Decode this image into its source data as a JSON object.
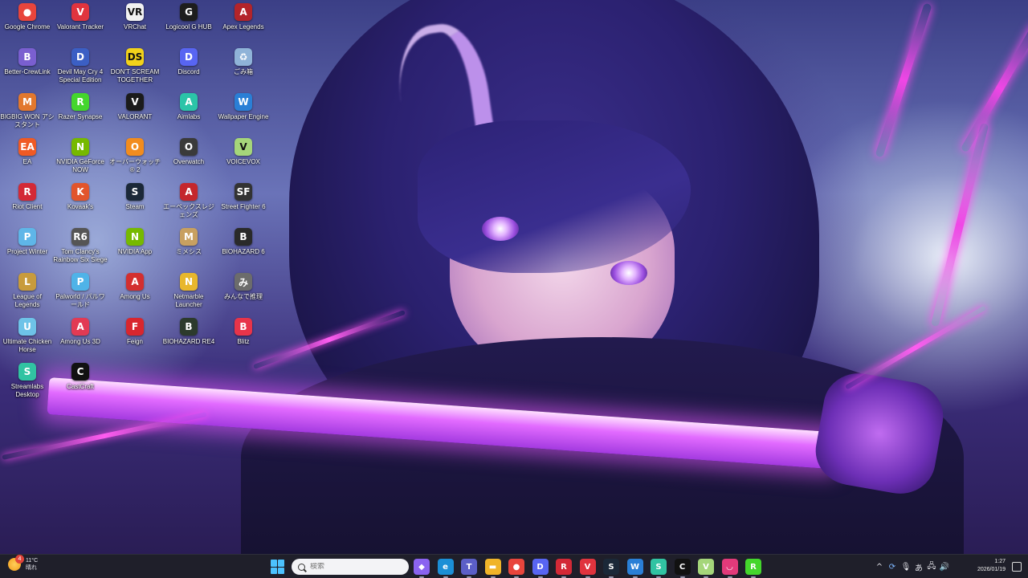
{
  "desktop": {
    "icons": [
      {
        "label": "Google Chrome",
        "glyph": "●",
        "color": "#e8453c"
      },
      {
        "label": "Valorant Tracker",
        "glyph": "V",
        "color": "#e0343e"
      },
      {
        "label": "VRChat",
        "glyph": "VR",
        "color": "#f2f2f2"
      },
      {
        "label": "Logicool G HUB",
        "glyph": "G",
        "color": "#1d1d1d"
      },
      {
        "label": "Apex Legends",
        "glyph": "A",
        "color": "#b3242a"
      },
      {
        "label": "Better-CrewLink",
        "glyph": "B",
        "color": "#7a5fd0"
      },
      {
        "label": "Devil May Cry 4 Special Edition",
        "glyph": "D",
        "color": "#3b5fc4"
      },
      {
        "label": "DON'T SCREAM TOGETHER",
        "glyph": "DS",
        "color": "#f2d21a"
      },
      {
        "label": "Discord",
        "glyph": "D",
        "color": "#5865f2"
      },
      {
        "label": "ごみ箱",
        "glyph": "♻",
        "color": "#8fb3d8"
      },
      {
        "label": "BIGBIG WON アシスタント",
        "glyph": "M",
        "color": "#e2782e"
      },
      {
        "label": "Razer Synapse",
        "glyph": "R",
        "color": "#44d62c"
      },
      {
        "label": "VALORANT",
        "glyph": "V",
        "color": "#1b1b1b"
      },
      {
        "label": "Aimlabs",
        "glyph": "A",
        "color": "#2bc4a8"
      },
      {
        "label": "Wallpaper Engine",
        "glyph": "W",
        "color": "#2a7fd6"
      },
      {
        "label": "EA",
        "glyph": "EA",
        "color": "#f05a24"
      },
      {
        "label": "NVIDIA GeForce NOW",
        "glyph": "N",
        "color": "#76b900"
      },
      {
        "label": "オーバーウォッチ® 2",
        "glyph": "O",
        "color": "#f28c1e"
      },
      {
        "label": "Overwatch",
        "glyph": "O",
        "color": "#3a3a3a"
      },
      {
        "label": "VOICEVOX",
        "glyph": "V",
        "color": "#a5d67a"
      },
      {
        "label": "Riot Client",
        "glyph": "R",
        "color": "#d32936"
      },
      {
        "label": "Kovaak's",
        "glyph": "K",
        "color": "#e2552c"
      },
      {
        "label": "Steam",
        "glyph": "S",
        "color": "#1b2838"
      },
      {
        "label": "エーペックスレジェンズ",
        "glyph": "A",
        "color": "#c4272d"
      },
      {
        "label": "Street Fighter 6",
        "glyph": "SF",
        "color": "#333333"
      },
      {
        "label": "Project Winter",
        "glyph": "P",
        "color": "#5fb6e8"
      },
      {
        "label": "Tom Clancy's Rainbow Six Siege",
        "glyph": "R6",
        "color": "#555555"
      },
      {
        "label": "NVIDIA App",
        "glyph": "N",
        "color": "#76b900"
      },
      {
        "label": "ミメシス",
        "glyph": "M",
        "color": "#c8a060"
      },
      {
        "label": "BIOHAZARD 6",
        "glyph": "B",
        "color": "#2a2a2a"
      },
      {
        "label": "League of Legends",
        "glyph": "L",
        "color": "#c89b3c"
      },
      {
        "label": "Palworld / パルワールド",
        "glyph": "P",
        "color": "#4fb3e8"
      },
      {
        "label": "Among Us",
        "glyph": "A",
        "color": "#d32f2f"
      },
      {
        "label": "Netmarble Launcher",
        "glyph": "N",
        "color": "#e8b72c"
      },
      {
        "label": "みんなで推理",
        "glyph": "み",
        "color": "#6c6c6c"
      },
      {
        "label": "Ultimate Chicken Horse",
        "glyph": "U",
        "color": "#6ec3e8"
      },
      {
        "label": "Among Us 3D",
        "glyph": "A",
        "color": "#e23a54"
      },
      {
        "label": "Feign",
        "glyph": "F",
        "color": "#d9262e"
      },
      {
        "label": "BIOHAZARD RE4",
        "glyph": "B",
        "color": "#2c3a2c"
      },
      {
        "label": "Blitz",
        "glyph": "B",
        "color": "#e8344a"
      },
      {
        "label": "Streamlabs Desktop",
        "glyph": "S",
        "color": "#31c3a2"
      },
      {
        "label": "CastCraft",
        "glyph": "C",
        "color": "#111111"
      }
    ]
  },
  "taskbar": {
    "weather": {
      "temp": "11°C",
      "condition": "晴れ",
      "badge": "4"
    },
    "search_placeholder": "検索",
    "apps": [
      {
        "name": "copilot-app",
        "glyph": "◆",
        "color": "#8a63f0"
      },
      {
        "name": "edge-app",
        "glyph": "e",
        "color": "#1b8fd6"
      },
      {
        "name": "teams-app",
        "glyph": "T",
        "color": "#5b5fc7"
      },
      {
        "name": "file-explorer-app",
        "glyph": "▬",
        "color": "#f0b429"
      },
      {
        "name": "chrome-app",
        "glyph": "●",
        "color": "#e8453c"
      },
      {
        "name": "discord-app",
        "glyph": "D",
        "color": "#5865f2"
      },
      {
        "name": "riot-client-app",
        "glyph": "R",
        "color": "#d32936"
      },
      {
        "name": "valorant-tracker-app",
        "glyph": "V",
        "color": "#e0343e"
      },
      {
        "name": "steam-app",
        "glyph": "S",
        "color": "#1b2838"
      },
      {
        "name": "wallpaper-engine-app",
        "glyph": "W",
        "color": "#2a7fd6"
      },
      {
        "name": "streamlabs-app",
        "glyph": "S",
        "color": "#31c3a2"
      },
      {
        "name": "castcraft-app",
        "glyph": "C",
        "color": "#111111"
      },
      {
        "name": "voicevox-app",
        "glyph": "V",
        "color": "#a5d67a"
      },
      {
        "name": "lips-app",
        "glyph": "◡",
        "color": "#e23a7a"
      },
      {
        "name": "razer-app",
        "glyph": "R",
        "color": "#44d62c"
      }
    ],
    "tray": {
      "ime": "あ",
      "time": "1:27",
      "date": "2026/01/19"
    }
  }
}
